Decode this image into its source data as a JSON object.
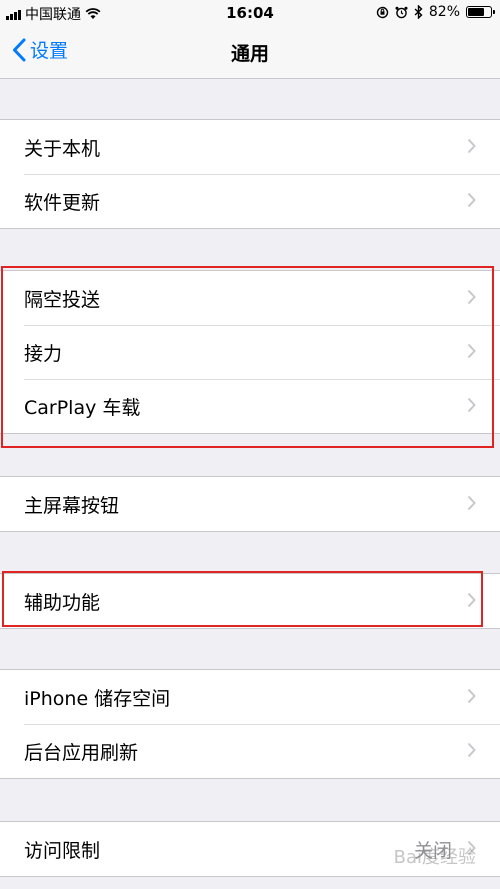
{
  "status_bar": {
    "carrier": "中国联通",
    "time": "16:04",
    "battery_percent": "82%",
    "battery_level": 0.82,
    "icons": [
      "signal-icon",
      "wifi-icon",
      "rotation-lock-icon",
      "alarm-icon",
      "bluetooth-icon",
      "battery-icon"
    ]
  },
  "nav": {
    "back_label": "设置",
    "title": "通用"
  },
  "groups": [
    {
      "items": [
        {
          "label": "关于本机"
        },
        {
          "label": "软件更新"
        }
      ]
    },
    {
      "items": [
        {
          "label": "隔空投送"
        },
        {
          "label": "接力"
        },
        {
          "label": "CarPlay 车载"
        }
      ]
    },
    {
      "items": [
        {
          "label": "主屏幕按钮"
        }
      ]
    },
    {
      "items": [
        {
          "label": "辅助功能"
        }
      ]
    },
    {
      "items": [
        {
          "label": "iPhone 储存空间"
        },
        {
          "label": "后台应用刷新"
        }
      ]
    },
    {
      "items": [
        {
          "label": "访问限制",
          "value": "关闭"
        }
      ]
    }
  ],
  "watermark": "Bai度经验",
  "colors": {
    "accent": "#007aff",
    "highlight": "#e02424",
    "background": "#efeff4",
    "chevron": "#c7c7cc"
  }
}
